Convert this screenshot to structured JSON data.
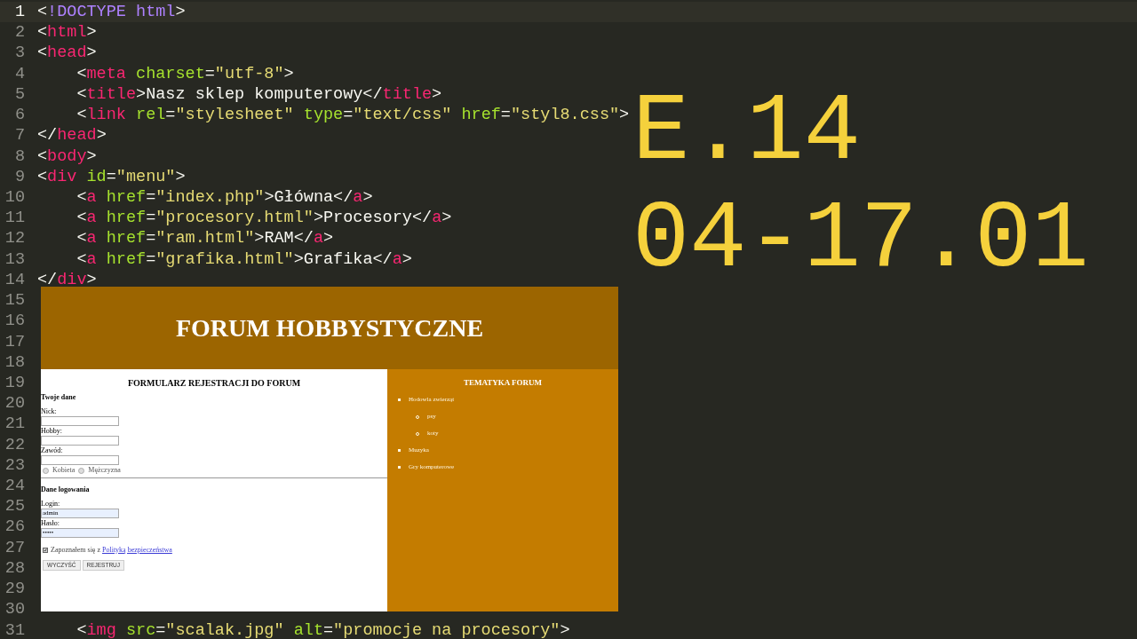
{
  "editor": {
    "lines": [
      {
        "number": "1",
        "current": true,
        "tokens": [
          {
            "kind": "punct",
            "text": "<"
          },
          {
            "kind": "doctype",
            "text": "!DOCTYPE html"
          },
          {
            "kind": "punct",
            "text": ">"
          }
        ]
      },
      {
        "number": "2",
        "current": false,
        "tokens": [
          {
            "kind": "punct",
            "text": "<"
          },
          {
            "kind": "tag",
            "text": "html"
          },
          {
            "kind": "punct",
            "text": ">"
          }
        ]
      },
      {
        "number": "3",
        "current": false,
        "tokens": [
          {
            "kind": "punct",
            "text": "<"
          },
          {
            "kind": "tag",
            "text": "head"
          },
          {
            "kind": "punct",
            "text": ">"
          }
        ]
      },
      {
        "number": "4",
        "current": false,
        "indent": true,
        "tokens": [
          {
            "kind": "punct",
            "text": "<"
          },
          {
            "kind": "tag",
            "text": "meta"
          },
          {
            "kind": "attr",
            "text": "charset",
            "gap": true
          },
          {
            "kind": "punct",
            "text": "="
          },
          {
            "kind": "string",
            "text": "\"utf-8\""
          },
          {
            "kind": "punct",
            "text": ">"
          }
        ]
      },
      {
        "number": "5",
        "current": false,
        "indent": true,
        "tokens": [
          {
            "kind": "punct",
            "text": "<"
          },
          {
            "kind": "tag",
            "text": "title"
          },
          {
            "kind": "punct",
            "text": ">Nasz sklep komputerowy</"
          },
          {
            "kind": "tag",
            "text": "title"
          },
          {
            "kind": "punct",
            "text": ">"
          }
        ]
      },
      {
        "number": "6",
        "current": false,
        "indent": true,
        "tokens": [
          {
            "kind": "punct",
            "text": "<"
          },
          {
            "kind": "tag",
            "text": "link"
          },
          {
            "kind": "attr",
            "text": "rel",
            "gap": true
          },
          {
            "kind": "punct",
            "text": "="
          },
          {
            "kind": "string",
            "text": "\"stylesheet\""
          },
          {
            "kind": "attr",
            "text": "type",
            "gap": true
          },
          {
            "kind": "punct",
            "text": "="
          },
          {
            "kind": "string",
            "text": "\"text/css\""
          },
          {
            "kind": "attr",
            "text": "href",
            "gap": true
          },
          {
            "kind": "punct",
            "text": "="
          },
          {
            "kind": "string",
            "text": "\"styl8.css\""
          },
          {
            "kind": "punct",
            "text": ">"
          }
        ]
      },
      {
        "number": "7",
        "current": false,
        "tokens": [
          {
            "kind": "punct",
            "text": "</"
          },
          {
            "kind": "tag",
            "text": "head"
          },
          {
            "kind": "punct",
            "text": ">"
          }
        ]
      },
      {
        "number": "8",
        "current": false,
        "tokens": [
          {
            "kind": "punct",
            "text": "<"
          },
          {
            "kind": "tag",
            "text": "body"
          },
          {
            "kind": "punct",
            "text": ">"
          }
        ]
      },
      {
        "number": "9",
        "current": false,
        "tokens": [
          {
            "kind": "punct",
            "text": "<"
          },
          {
            "kind": "tag",
            "text": "div"
          },
          {
            "kind": "attr",
            "text": "id",
            "gap": true
          },
          {
            "kind": "punct",
            "text": "="
          },
          {
            "kind": "string",
            "text": "\"menu\""
          },
          {
            "kind": "punct",
            "text": ">"
          }
        ]
      },
      {
        "number": "10",
        "current": false,
        "indent": true,
        "tokens": [
          {
            "kind": "punct",
            "text": "<"
          },
          {
            "kind": "tag",
            "text": "a"
          },
          {
            "kind": "attr",
            "text": "href",
            "gap": true
          },
          {
            "kind": "punct",
            "text": "="
          },
          {
            "kind": "string",
            "text": "\"index.php\""
          },
          {
            "kind": "punct",
            "text": ">Główna</"
          },
          {
            "kind": "tag",
            "text": "a"
          },
          {
            "kind": "punct",
            "text": ">"
          }
        ]
      },
      {
        "number": "11",
        "current": false,
        "indent": true,
        "tokens": [
          {
            "kind": "punct",
            "text": "<"
          },
          {
            "kind": "tag",
            "text": "a"
          },
          {
            "kind": "attr",
            "text": "href",
            "gap": true
          },
          {
            "kind": "punct",
            "text": "="
          },
          {
            "kind": "string",
            "text": "\"procesory.html\""
          },
          {
            "kind": "punct",
            "text": ">Procesory</"
          },
          {
            "kind": "tag",
            "text": "a"
          },
          {
            "kind": "punct",
            "text": ">"
          }
        ]
      },
      {
        "number": "12",
        "current": false,
        "indent": true,
        "tokens": [
          {
            "kind": "punct",
            "text": "<"
          },
          {
            "kind": "tag",
            "text": "a"
          },
          {
            "kind": "attr",
            "text": "href",
            "gap": true
          },
          {
            "kind": "punct",
            "text": "="
          },
          {
            "kind": "string",
            "text": "\"ram.html\""
          },
          {
            "kind": "punct",
            "text": ">RAM</"
          },
          {
            "kind": "tag",
            "text": "a"
          },
          {
            "kind": "punct",
            "text": ">"
          }
        ]
      },
      {
        "number": "13",
        "current": false,
        "indent": true,
        "tokens": [
          {
            "kind": "punct",
            "text": "<"
          },
          {
            "kind": "tag",
            "text": "a"
          },
          {
            "kind": "attr",
            "text": "href",
            "gap": true
          },
          {
            "kind": "punct",
            "text": "="
          },
          {
            "kind": "string",
            "text": "\"grafika.html\""
          },
          {
            "kind": "punct",
            "text": ">Grafika</"
          },
          {
            "kind": "tag",
            "text": "a"
          },
          {
            "kind": "punct",
            "text": ">"
          }
        ]
      },
      {
        "number": "14",
        "current": false,
        "tokens": [
          {
            "kind": "punct",
            "text": "</"
          },
          {
            "kind": "tag",
            "text": "div"
          },
          {
            "kind": "punct",
            "text": ">"
          }
        ]
      },
      {
        "number": "15",
        "current": false
      },
      {
        "number": "16",
        "current": false
      },
      {
        "number": "17",
        "current": false
      },
      {
        "number": "18",
        "current": false
      },
      {
        "number": "19",
        "current": false
      },
      {
        "number": "20",
        "current": false
      },
      {
        "number": "21",
        "current": false
      },
      {
        "number": "22",
        "current": false
      },
      {
        "number": "23",
        "current": false
      },
      {
        "number": "24",
        "current": false
      },
      {
        "number": "25",
        "current": false
      },
      {
        "number": "26",
        "current": false
      },
      {
        "number": "27",
        "current": false
      },
      {
        "number": "28",
        "current": false
      },
      {
        "number": "29",
        "current": false
      },
      {
        "number": "30",
        "current": false
      },
      {
        "number": "31",
        "current": false,
        "indent": true,
        "tokens": [
          {
            "kind": "punct",
            "text": "<"
          },
          {
            "kind": "tag",
            "text": "img"
          },
          {
            "kind": "attr",
            "text": "src",
            "gap": true
          },
          {
            "kind": "punct",
            "text": "="
          },
          {
            "kind": "string",
            "text": "\"scalak.jpg\""
          },
          {
            "kind": "attr",
            "text": "alt",
            "gap": true
          },
          {
            "kind": "punct",
            "text": "="
          },
          {
            "kind": "string",
            "text": "\"promocje na procesory\""
          },
          {
            "kind": "punct",
            "text": ">"
          }
        ]
      }
    ]
  },
  "caption": [
    "E.14",
    "04-17.01"
  ],
  "preview": {
    "header": "FORUM HOBBYSTYCZNE",
    "form": {
      "title": "FORMULARZ REJESTRACJI DO FORUM",
      "personal": {
        "heading": "Twoje dane",
        "fields": [
          {
            "label": "Nick:"
          },
          {
            "label": "Hobby:"
          },
          {
            "label": "Zawód:"
          }
        ],
        "radios": [
          {
            "label": "Kobieta",
            "selected": false
          },
          {
            "label": "Mężczyzna",
            "selected": false
          }
        ]
      },
      "login": {
        "heading": "Dane logowania",
        "fields": [
          {
            "label": "Login:",
            "value": "admin",
            "autofilled": true
          },
          {
            "label": "Hasło:",
            "value": "•••••",
            "autofilled": true
          }
        ]
      },
      "consent": {
        "checked": true,
        "text": "Zapoznałem się z",
        "link": "Polityką bezpieczeństwa"
      },
      "buttons": [
        "WYCZYŚĆ",
        "REJESTRUJ"
      ]
    },
    "sidebar": {
      "title": "TEMATYKA FORUM",
      "topics": [
        {
          "label": "Hodowla zwierząt",
          "children": [
            {
              "label": "psy"
            },
            {
              "label": "koty"
            }
          ]
        },
        {
          "label": "Muzyka"
        },
        {
          "label": "Gry komputerowe"
        }
      ]
    }
  }
}
